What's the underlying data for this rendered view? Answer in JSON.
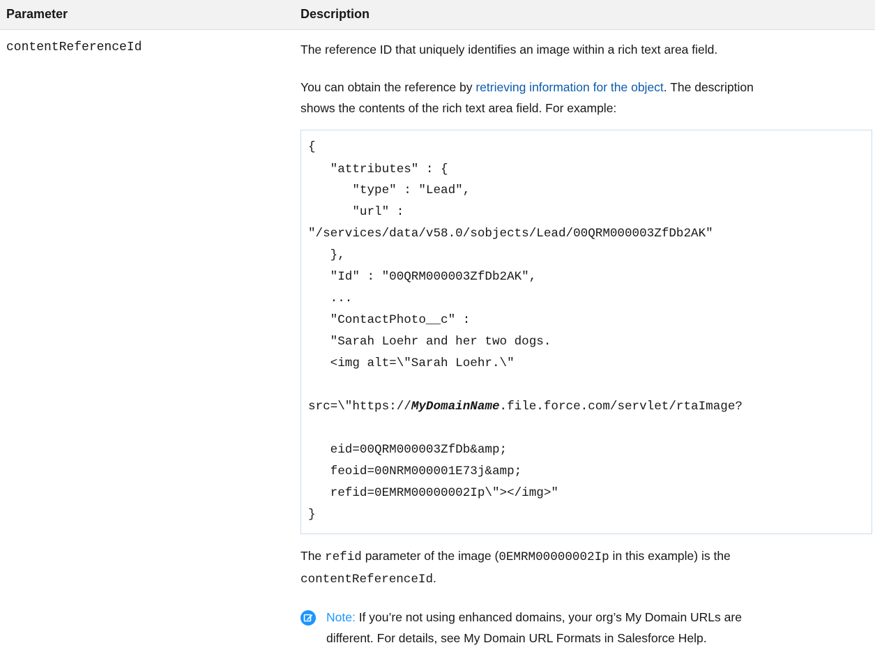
{
  "table": {
    "headers": {
      "parameter": "Parameter",
      "description": "Description"
    },
    "row": {
      "parameter": "contentReferenceId",
      "desc_line1": "The reference ID that uniquely identifies an image within a rich text area field.",
      "desc2_before_link": "You can obtain the reference by ",
      "desc2_link": "retrieving information for the object",
      "desc2_after_link_l1": ". The description",
      "desc2_line2": "shows the contents of the rich text area field. For example:",
      "code_lines": [
        "{",
        "   \"attributes\" : {",
        "      \"type\" : \"Lead\",",
        "      \"url\" :",
        "\"/services/data/v58.0/sobjects/Lead/00QRM000003ZfDb2AK\"",
        "   },",
        "   \"Id\" : \"00QRM000003ZfDb2AK\",",
        "   ...",
        "   \"ContactPhoto__c\" :",
        "   \"Sarah Loehr and her two dogs.",
        "   <img alt=\\\"Sarah Loehr.\\\""
      ],
      "code_src_prefix": "src=\\\"https://",
      "code_src_em": "MyDomainName",
      "code_src_suffix": ".file.force.com/servlet/rtaImage?",
      "code_lines_tail": [
        "   eid=00QRM000003ZfDb&amp;",
        "   feoid=00NRM000001E73j&amp;",
        "   refid=0EMRM00000002Ip\\\"></img>\"",
        "}"
      ],
      "desc3_t1": "The ",
      "desc3_code1": "refid",
      "desc3_t2": " parameter of the image (",
      "desc3_code2": "0EMRM00000002Ip",
      "desc3_t3": " in this example) is the",
      "desc3_code3": "contentReferenceId",
      "desc3_t4": ".",
      "note_label": "Note:",
      "note_l1": " If you’re not using enhanced domains, your org’s My Domain URLs are",
      "note_l2": "different. For details, see My Domain URL Formats in Salesforce Help."
    }
  },
  "icons": {
    "note": "note-edit-icon"
  },
  "colors": {
    "header_bg": "#f3f2f2",
    "link": "#0b5cab",
    "note_accent": "#1b96ff",
    "code_border": "#c9dcee"
  }
}
